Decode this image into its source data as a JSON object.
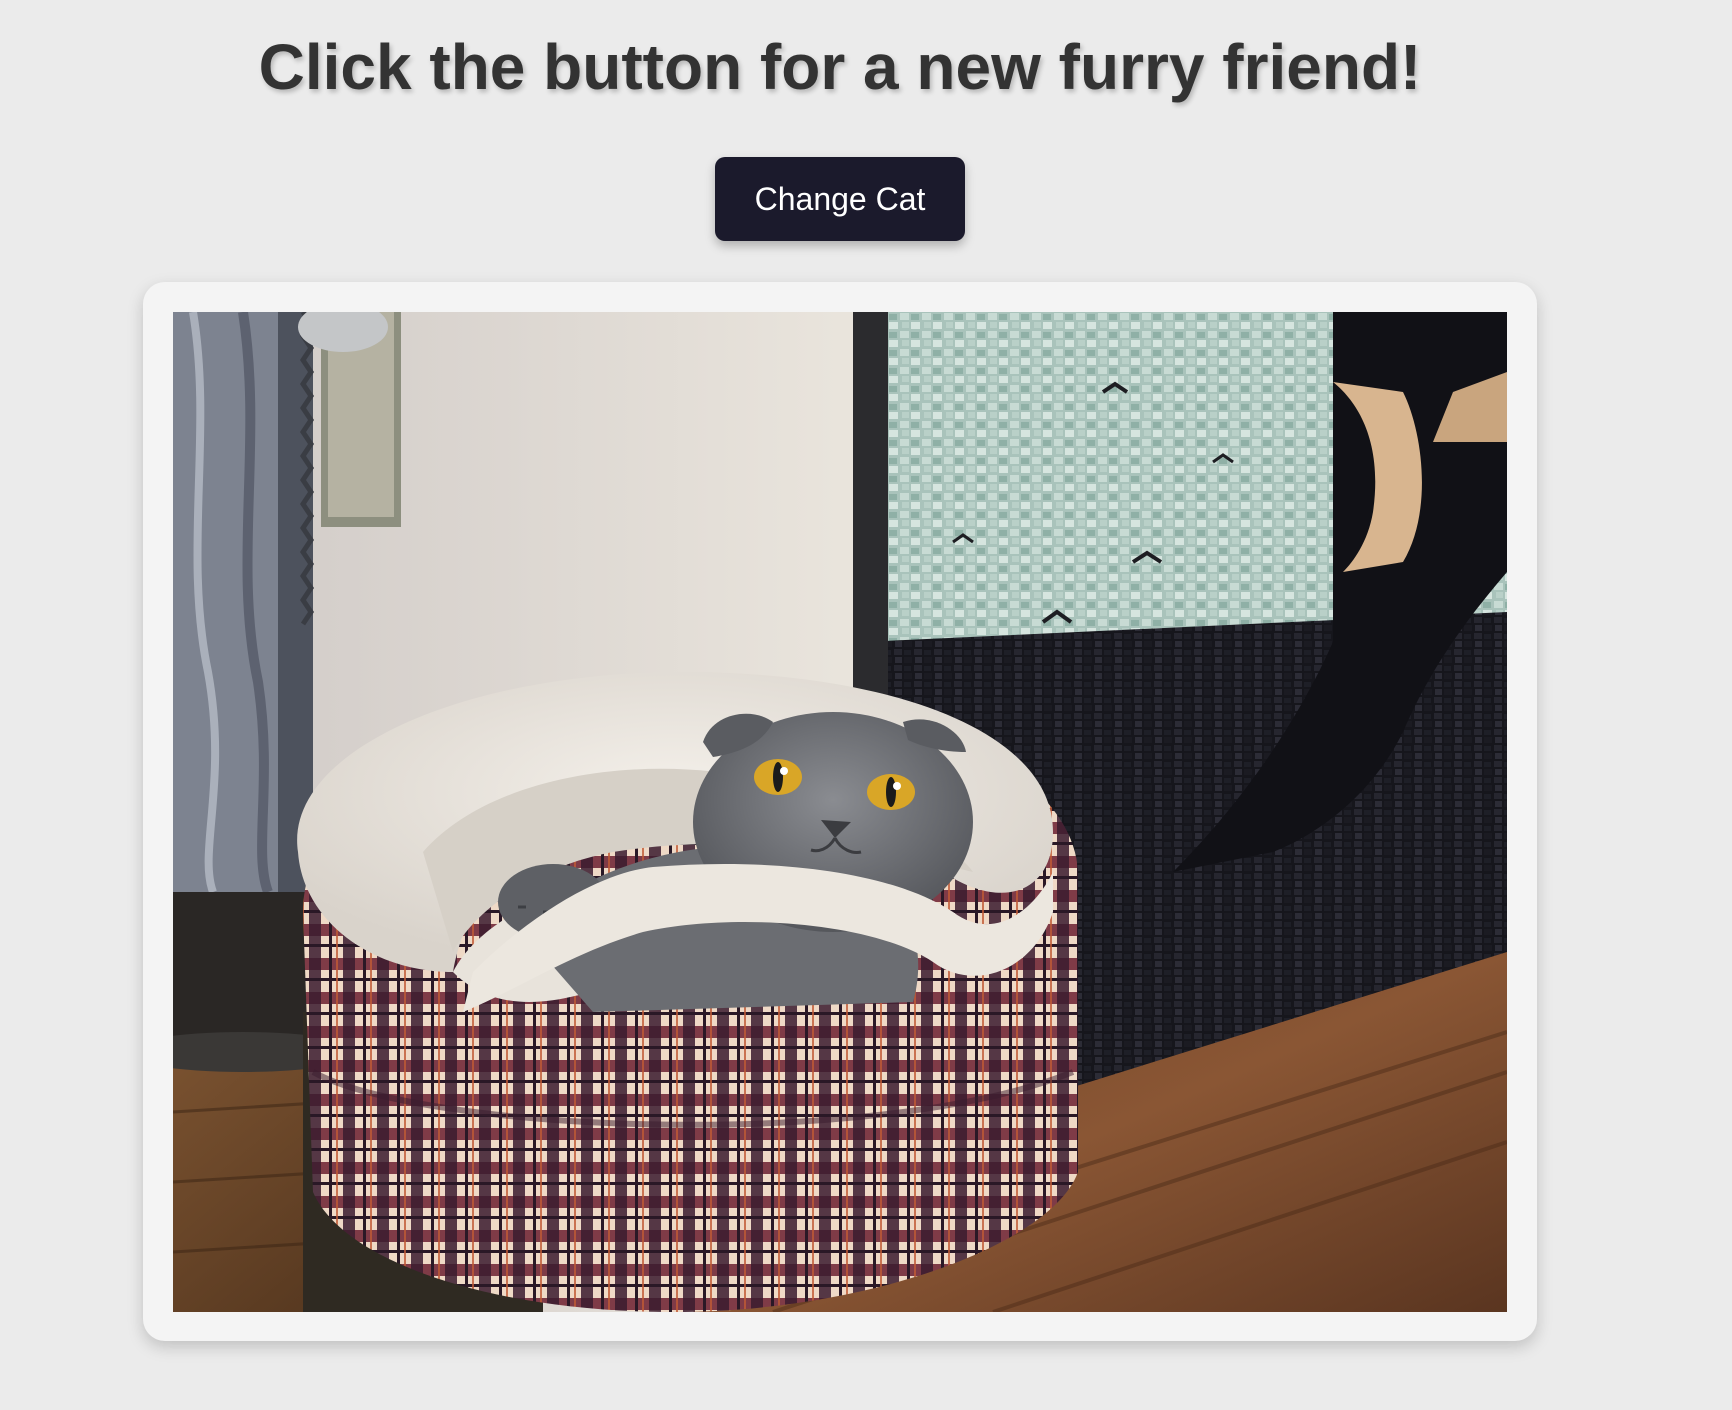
{
  "page": {
    "heading": "Click the button for a new furry friend!",
    "button_label": "Change Cat"
  },
  "image": {
    "alt": "",
    "subject": "cat-photo"
  },
  "colors": {
    "background": "#ebebeb",
    "heading": "#333333",
    "button_bg": "#1b1a2c",
    "button_text": "#ffffff",
    "card_bg": "#f4f4f4"
  }
}
